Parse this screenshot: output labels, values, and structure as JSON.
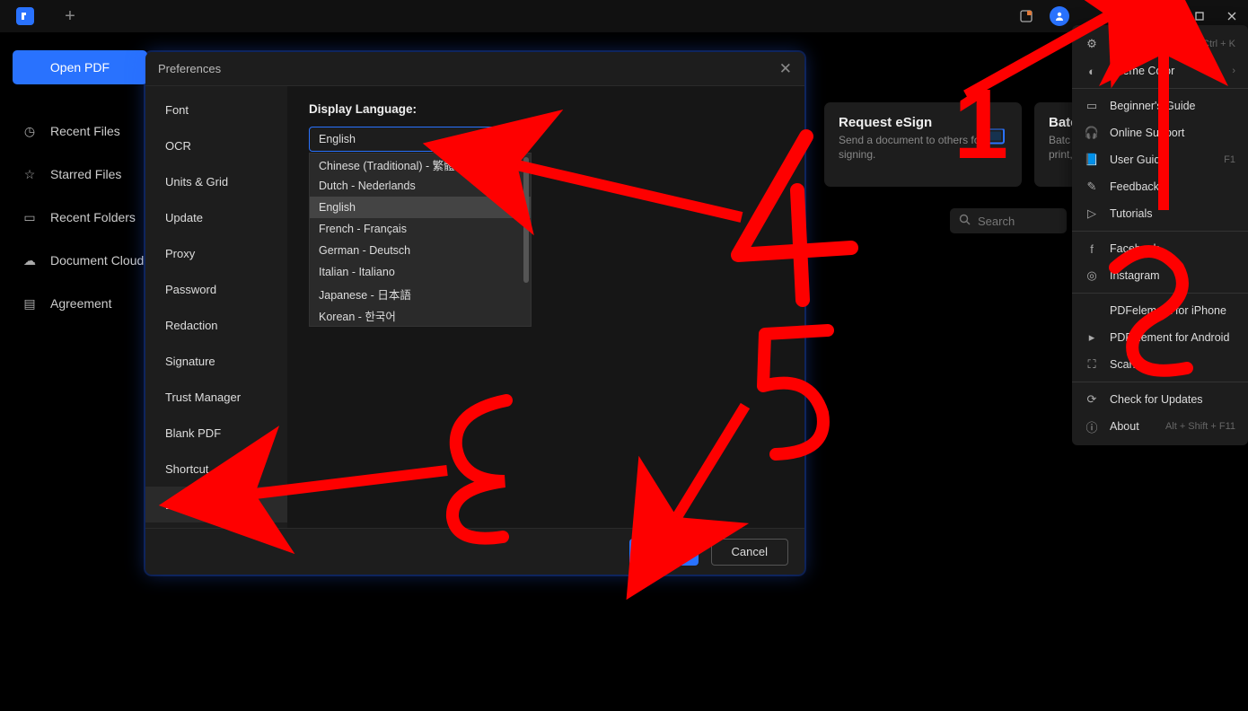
{
  "titlebar": {
    "more_icon": "⋮"
  },
  "sidebar": {
    "open_pdf": "Open PDF",
    "items": [
      {
        "icon": "◷",
        "label": "Recent Files"
      },
      {
        "icon": "☆",
        "label": "Starred Files"
      },
      {
        "icon": "▭",
        "label": "Recent Folders"
      },
      {
        "icon": "☁",
        "label": "Document Cloud"
      },
      {
        "icon": "▤",
        "label": "Agreement"
      }
    ]
  },
  "cards": {
    "esign": {
      "title": "Request eSign",
      "sub": "Send a document to others for signing."
    },
    "batch": {
      "title": "Batc",
      "sub": "Batc\nprint,"
    }
  },
  "search": {
    "placeholder": "Search"
  },
  "menu": {
    "items": [
      {
        "icon": "⚙",
        "label": "Preferences",
        "kb": "Ctrl + K"
      },
      {
        "icon": "◐",
        "label": "Theme Color",
        "kb": "›"
      },
      {
        "sep": true
      },
      {
        "icon": "▭",
        "label": "Beginner's Guide"
      },
      {
        "icon": "🎧",
        "label": "Online Support"
      },
      {
        "icon": "📘",
        "label": "User Guide",
        "kb": "F1"
      },
      {
        "icon": "✎",
        "label": "Feedback"
      },
      {
        "icon": "▷",
        "label": "Tutorials"
      },
      {
        "sep": true
      },
      {
        "icon": "f",
        "label": "Facebook"
      },
      {
        "icon": "◎",
        "label": "Instagram"
      },
      {
        "sep": true
      },
      {
        "icon": "",
        "label": "PDFelement for iPhone"
      },
      {
        "icon": "▸",
        "label": "PDFelement for Android"
      },
      {
        "icon": "⛶",
        "label": "Scan"
      },
      {
        "sep": true
      },
      {
        "icon": "⟳",
        "label": "Check for Updates"
      },
      {
        "icon": "ⓘ",
        "label": "About",
        "kb": "Alt + Shift + F11"
      }
    ]
  },
  "dialog": {
    "title": "Preferences",
    "tabs": [
      "Font",
      "OCR",
      "Units & Grid",
      "Update",
      "Proxy",
      "Password",
      "Redaction",
      "Signature",
      "Trust Manager",
      "Blank PDF",
      "Shortcut",
      "Language"
    ],
    "active_tab": "Language",
    "content_label": "Display Language:",
    "combo_value": "English",
    "combo_items": [
      "Chinese (Traditional) - 繁體中文",
      "Dutch - Nederlands",
      "English",
      "French - Français",
      "German - Deutsch",
      "Italian - Italiano",
      "Japanese - 日本語",
      "Korean - 한국어"
    ],
    "combo_selected": "English",
    "apply": "Apply",
    "cancel": "Cancel"
  },
  "annotations": {
    "n1": "1",
    "n2": "2",
    "n3": "3",
    "n4": "4",
    "n5": "5"
  }
}
